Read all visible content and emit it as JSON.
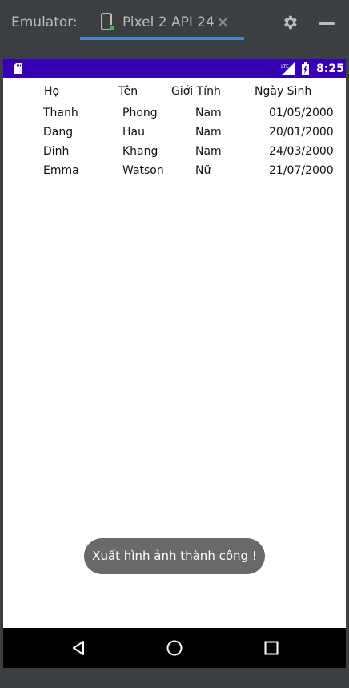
{
  "emulator": {
    "label": "Emulator:",
    "tab_title": "Pixel 2 API 24",
    "close_glyph": "✕"
  },
  "status_bar": {
    "time": "8:25",
    "network": "LTE",
    "color": "#3700b3"
  },
  "table": {
    "headers": [
      "Họ",
      "Tên",
      "Giới Tính",
      "Ngày Sinh"
    ],
    "rows": [
      [
        "Thanh",
        "Phong",
        "Nam",
        "01/05/2000"
      ],
      [
        "Dang",
        "Hau",
        "Nam",
        "20/01/2000"
      ],
      [
        "Dinh",
        "Khang",
        "Nam",
        "24/03/2000"
      ],
      [
        "Emma",
        "Watson",
        "Nữ",
        "21/07/2000"
      ]
    ]
  },
  "toast": {
    "message": "Xuất hình ảnh thành công !"
  },
  "nav_bar": {
    "icons": [
      "back-icon",
      "home-icon",
      "recents-icon"
    ]
  }
}
